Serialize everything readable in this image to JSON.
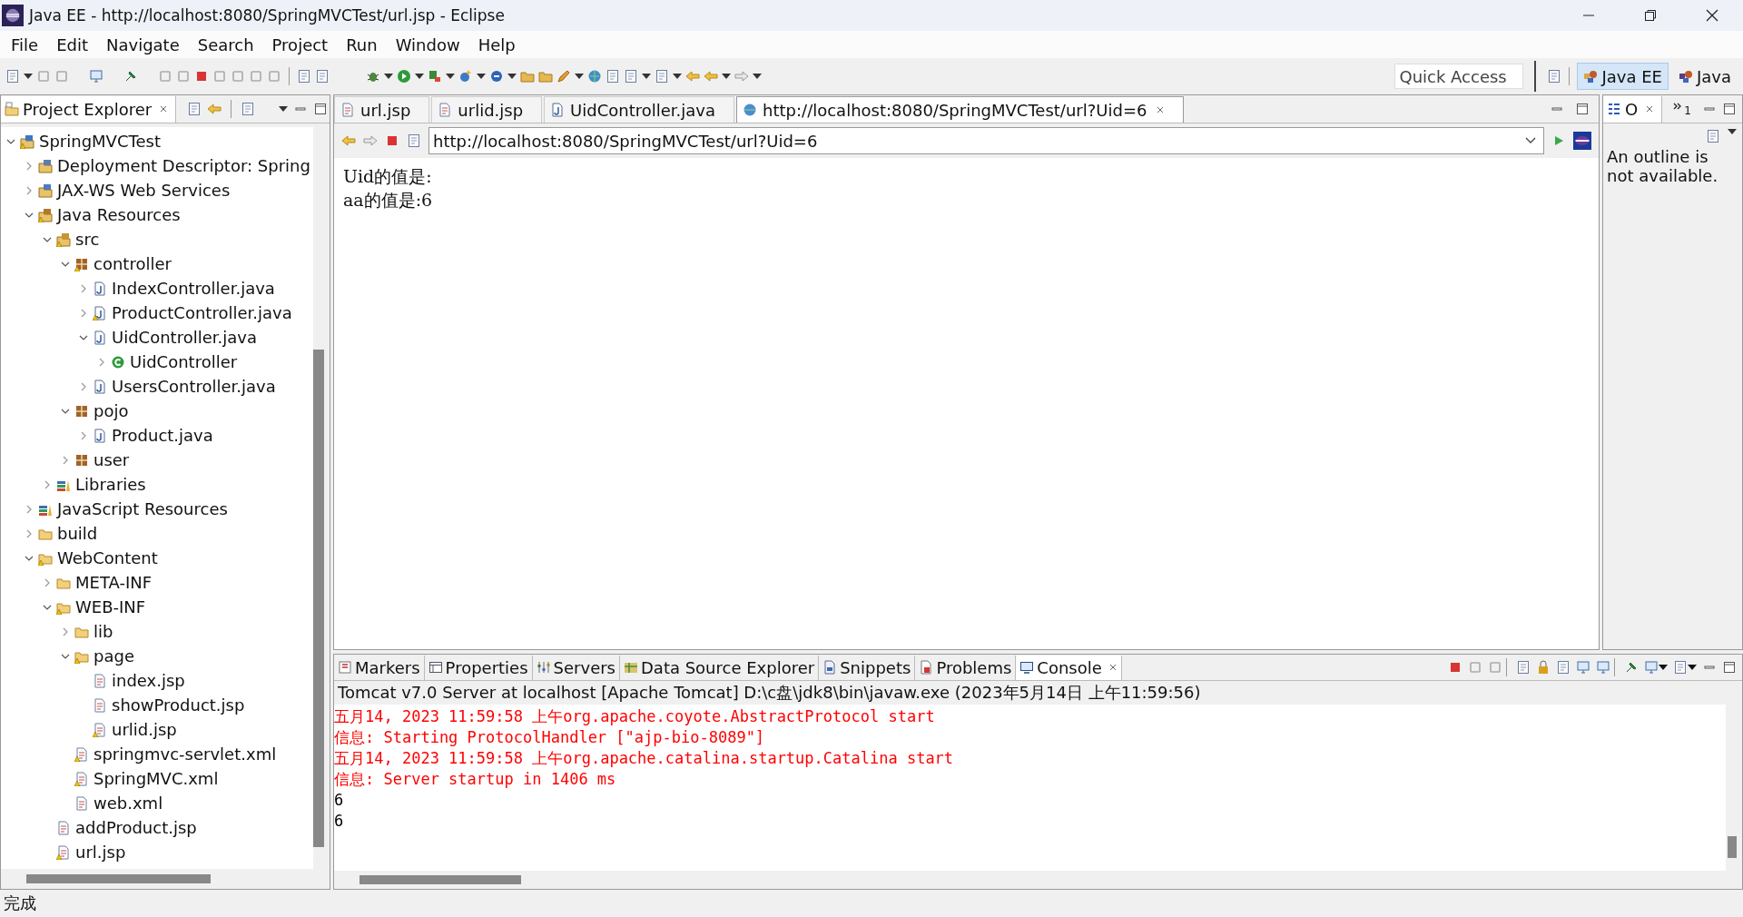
{
  "window": {
    "title": "Java EE - http://localhost:8080/SpringMVCTest/url.jsp - Eclipse"
  },
  "menu": [
    "File",
    "Edit",
    "Navigate",
    "Search",
    "Project",
    "Run",
    "Window",
    "Help"
  ],
  "quick_access": {
    "placeholder": "Quick Access"
  },
  "perspectives": [
    {
      "label": "Java EE",
      "kind": "javaee",
      "selected": true
    },
    {
      "label": "Java",
      "kind": "java",
      "selected": false
    }
  ],
  "project_explorer": {
    "title": "Project Explorer",
    "tree": [
      {
        "label": "SpringMVCTest",
        "kind": "project",
        "warning": true,
        "expanded": true,
        "children": [
          {
            "label": "Deployment Descriptor: Spring",
            "kind": "descriptor",
            "warning": false,
            "expanded": false
          },
          {
            "label": "JAX-WS Web Services",
            "kind": "webservices",
            "warning": false,
            "expanded": false
          },
          {
            "label": "Java Resources",
            "kind": "resources",
            "warning": true,
            "expanded": true,
            "children": [
              {
                "label": "src",
                "kind": "source",
                "warning": true,
                "expanded": true,
                "children": [
                  {
                    "label": "controller",
                    "kind": "package",
                    "warning": true,
                    "expanded": true,
                    "children": [
                      {
                        "label": "IndexController.java",
                        "kind": "java",
                        "warning": false,
                        "expanded": false
                      },
                      {
                        "label": "ProductController.java",
                        "kind": "java",
                        "warning": true,
                        "expanded": false
                      },
                      {
                        "label": "UidController.java",
                        "kind": "java",
                        "warning": false,
                        "expanded": true,
                        "children": [
                          {
                            "label": "UidController",
                            "kind": "class",
                            "warning": false,
                            "expanded": false
                          }
                        ]
                      },
                      {
                        "label": "UsersController.java",
                        "kind": "java",
                        "warning": false,
                        "expanded": false
                      }
                    ]
                  },
                  {
                    "label": "pojo",
                    "kind": "package",
                    "warning": false,
                    "expanded": true,
                    "children": [
                      {
                        "label": "Product.java",
                        "kind": "java",
                        "warning": false,
                        "expanded": false
                      }
                    ]
                  },
                  {
                    "label": "user",
                    "kind": "package",
                    "warning": false,
                    "expanded": false
                  }
                ]
              },
              {
                "label": "Libraries",
                "kind": "library",
                "warning": false,
                "expanded": false
              }
            ]
          },
          {
            "label": "JavaScript Resources",
            "kind": "library",
            "warning": false,
            "expanded": false
          },
          {
            "label": "build",
            "kind": "folder",
            "warning": false,
            "expanded": false
          },
          {
            "label": "WebContent",
            "kind": "folder",
            "warning": true,
            "expanded": true,
            "children": [
              {
                "label": "META-INF",
                "kind": "folder",
                "warning": false,
                "expanded": false
              },
              {
                "label": "WEB-INF",
                "kind": "folder",
                "warning": true,
                "expanded": true,
                "children": [
                  {
                    "label": "lib",
                    "kind": "folder",
                    "warning": false,
                    "expanded": false
                  },
                  {
                    "label": "page",
                    "kind": "folder",
                    "warning": true,
                    "expanded": true,
                    "children": [
                      {
                        "label": "index.jsp",
                        "kind": "jsp",
                        "warning": false
                      },
                      {
                        "label": "showProduct.jsp",
                        "kind": "jsp",
                        "warning": false
                      },
                      {
                        "label": "urlid.jsp",
                        "kind": "jsp",
                        "warning": true
                      }
                    ]
                  },
                  {
                    "label": "springmvc-servlet.xml",
                    "kind": "xml",
                    "warning": true
                  },
                  {
                    "label": "SpringMVC.xml",
                    "kind": "xml",
                    "warning": true
                  },
                  {
                    "label": "web.xml",
                    "kind": "xml",
                    "warning": false
                  }
                ]
              },
              {
                "label": "addProduct.jsp",
                "kind": "jsp",
                "warning": false
              },
              {
                "label": "url.jsp",
                "kind": "jsp",
                "warning": true
              }
            ]
          }
        ]
      }
    ]
  },
  "editor_tabs": [
    {
      "label": "url.jsp",
      "kind": "jsp",
      "selected": false
    },
    {
      "label": "urlid.jsp",
      "kind": "jsp",
      "selected": false
    },
    {
      "label": "UidController.java",
      "kind": "java",
      "selected": false
    },
    {
      "label": "http://localhost:8080/SpringMVCTest/url?Uid=6",
      "kind": "web",
      "selected": true
    }
  ],
  "browser": {
    "url": "http://localhost:8080/SpringMVCTest/url?Uid=6",
    "content": [
      "Uid的值是:",
      "aa的值是:6"
    ]
  },
  "outline": {
    "tabs": [
      {
        "label": "O",
        "selected": true
      }
    ],
    "overflow": {
      "count": "1"
    },
    "message": "An outline is not available."
  },
  "bottom_tabs": [
    {
      "label": "Markers",
      "kind": "markers",
      "selected": false
    },
    {
      "label": "Properties",
      "kind": "properties",
      "selected": false
    },
    {
      "label": "Servers",
      "kind": "servers",
      "selected": false
    },
    {
      "label": "Data Source Explorer",
      "kind": "datasource",
      "selected": false
    },
    {
      "label": "Snippets",
      "kind": "snippets",
      "selected": false
    },
    {
      "label": "Problems",
      "kind": "problems",
      "selected": false
    },
    {
      "label": "Console",
      "kind": "console",
      "selected": true
    }
  ],
  "console": {
    "header": "Tomcat v7.0 Server at localhost [Apache Tomcat] D:\\c盘\\jdk8\\bin\\javaw.exe (2023年5月14日 上午11:59:56)",
    "lines": [
      {
        "text": "五月14, 2023 11:59:58 上午org.apache.coyote.AbstractProtocol start",
        "color": "#ff0000"
      },
      {
        "text": "信息: Starting ProtocolHandler [\"ajp-bio-8089\"]",
        "color": "#ff0000"
      },
      {
        "text": "五月14, 2023 11:59:58 上午org.apache.catalina.startup.Catalina start",
        "color": "#ff0000"
      },
      {
        "text": "信息: Server startup in 1406 ms",
        "color": "#ff0000"
      },
      {
        "text": "6",
        "color": "#000000"
      },
      {
        "text": "6",
        "color": "#000000"
      }
    ]
  },
  "status_bar": {
    "text": "完成"
  }
}
